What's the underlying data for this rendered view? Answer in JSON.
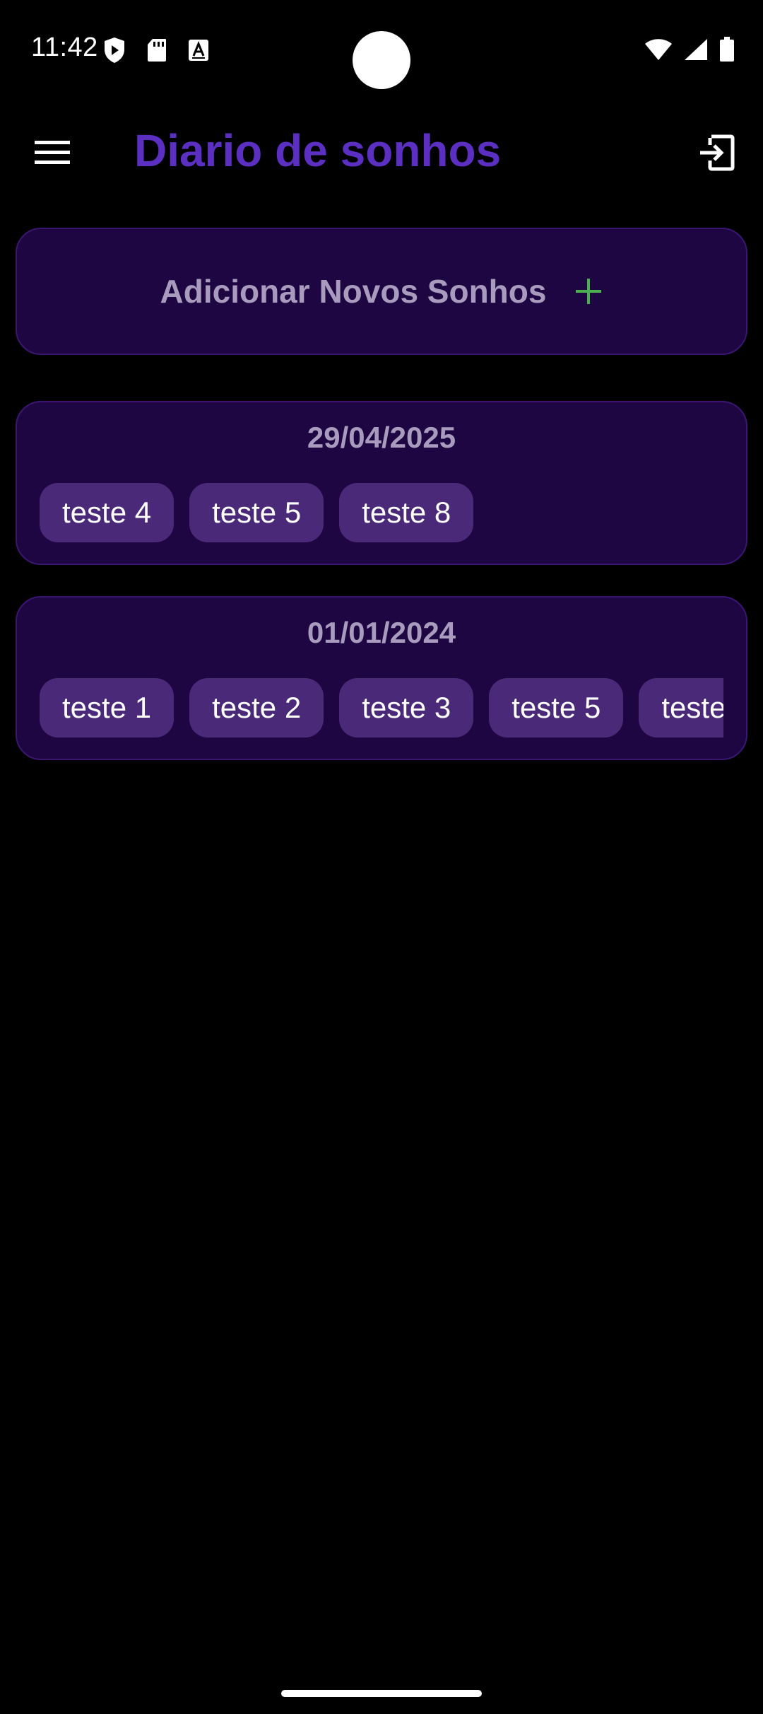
{
  "status_bar": {
    "time": "11:42",
    "left_icons": [
      "shield-play-icon",
      "sd-card-icon",
      "font-a-icon"
    ],
    "right_icons": [
      "wifi-icon",
      "signal-icon",
      "battery-icon"
    ]
  },
  "app_bar": {
    "title": "Diario de sonhos",
    "menu_icon": "menu-icon",
    "logout_icon": "logout-icon"
  },
  "add_card": {
    "label": "Adicionar Novos Sonhos",
    "icon": "plus-icon"
  },
  "dream_groups": [
    {
      "date": "29/04/2025",
      "tags": [
        "teste 4",
        "teste 5",
        "teste 8"
      ]
    },
    {
      "date": "01/01/2024",
      "tags": [
        "teste 1",
        "teste 2",
        "teste 3",
        "teste 5",
        "teste"
      ]
    }
  ],
  "colors": {
    "title": "#5a2fc1",
    "card_background": "#1e0642",
    "card_border": "#3a1670",
    "tag_background": "#4a2a78",
    "muted_text": "#a99bbd",
    "plus_accent": "#4caf50"
  }
}
